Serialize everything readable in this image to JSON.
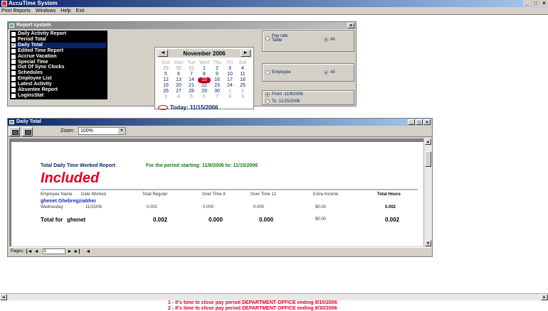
{
  "app": {
    "title": "AccuTime System",
    "controls": [
      "_",
      "□",
      "×"
    ]
  },
  "menu": [
    "Print Reports",
    "Windows",
    "Help",
    "Exit"
  ],
  "report_window": {
    "title": "Report system",
    "close": "×",
    "reports": [
      {
        "label": "Daily Activity Report",
        "checked": false
      },
      {
        "label": "Period Total",
        "checked": false
      },
      {
        "label": "Daily Total",
        "checked": true
      },
      {
        "label": "Edited Time Report",
        "checked": false
      },
      {
        "label": "Accrue Vacation",
        "checked": false
      },
      {
        "label": "Special Time",
        "checked": false
      },
      {
        "label": "Out Of Sync Clocks",
        "checked": false
      },
      {
        "label": "Schedules",
        "checked": false
      },
      {
        "label": "Employee List",
        "checked": false
      },
      {
        "label": "Latest Activity",
        "checked": false
      },
      {
        "label": "Absentee Report",
        "checked": false
      },
      {
        "label": "LoginsStat",
        "checked": false
      }
    ],
    "calendar": {
      "month": "November 2006",
      "prev": "◄",
      "next": "►",
      "weekdays": [
        "Sun",
        "Mon",
        "Tue",
        "Wed",
        "Thu",
        "Fri",
        "Sat"
      ],
      "weeks": [
        [
          "29",
          "30",
          "31",
          "1",
          "2",
          "3",
          "4"
        ],
        [
          "5",
          "6",
          "7",
          "8",
          "9",
          "10",
          "11"
        ],
        [
          "12",
          "13",
          "14",
          "15",
          "16",
          "17",
          "18"
        ],
        [
          "19",
          "20",
          "21",
          "22",
          "23",
          "24",
          "25"
        ],
        [
          "26",
          "27",
          "28",
          "29",
          "30",
          "1",
          "2"
        ],
        [
          "3",
          "4",
          "5",
          "6",
          "7",
          "8",
          "9"
        ]
      ],
      "today_label": "Today: 11/15/2006"
    },
    "options": {
      "pay_rate": "Pay rate Table",
      "all1": "All",
      "employee": "Employee",
      "all2": "All",
      "from": "From :11/8/2006",
      "to": "To :11/15/2006"
    }
  },
  "daily_window": {
    "title": "Daily Total",
    "zoom_label": "Zoom:",
    "zoom_value": "100%",
    "report": {
      "title": "Total Daily Time Worked Report",
      "period": "For the period starting: 11/8/2006 to: 11/15/2006",
      "included": "Included",
      "columns": [
        "Employee Name",
        "Date Worked",
        "Total Regular",
        "Over Time 8",
        "Over Time 12",
        "Extra Income",
        "Total Hours"
      ],
      "employee": "ghenet Ghebregziabher",
      "row": {
        "day": "Wednesday",
        "date": "11/15/06",
        "regular": "0.002",
        "ot8": "0.000",
        "ot12": "0.000",
        "extra": "$0.00",
        "total": "0.002"
      },
      "total_row": {
        "label": "Total for",
        "name": "ghenet",
        "regular": "0.002",
        "ot8": "0.000",
        "ot12": "0.000",
        "extra": "$0.00",
        "total": "0.002"
      }
    },
    "pager": {
      "label": "Pages:",
      "value": "1"
    }
  },
  "ticker": [
    "1 - It's time to close pay period  DEPARTMENT OFFICE  ending 8/15/2006",
    "2 - It's time to close pay period  DEPARTMENT OFFICE  ending 8/30/2006"
  ]
}
